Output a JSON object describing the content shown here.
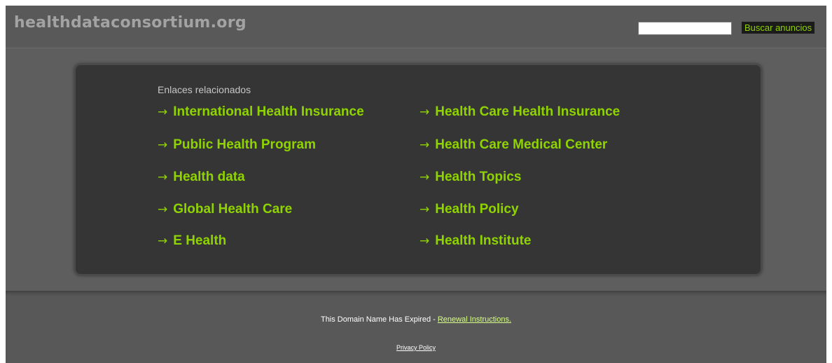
{
  "header": {
    "site_title": "healthdataconsortium.org",
    "search_button_label": "Buscar anuncios",
    "search_value": ""
  },
  "related": {
    "heading": "Enlaces relacionados",
    "arrow": "→",
    "links": [
      "International Health Insurance",
      "Health Care Health Insurance",
      "Public Health Program",
      "Health Care Medical Center",
      "Health data",
      "Health Topics",
      "Global Health Care",
      "Health Policy",
      "E Health",
      "Health Institute"
    ]
  },
  "footer": {
    "expired_text": "This Domain Name Has Expired - ",
    "renewal_link": "Renewal Instructions.",
    "privacy_link": "Privacy Policy"
  },
  "colors": {
    "accent_green": "#8fd400",
    "page_background": "#5c5c5c",
    "panel_background": "#353535",
    "title_grey": "#a3a3a3"
  }
}
